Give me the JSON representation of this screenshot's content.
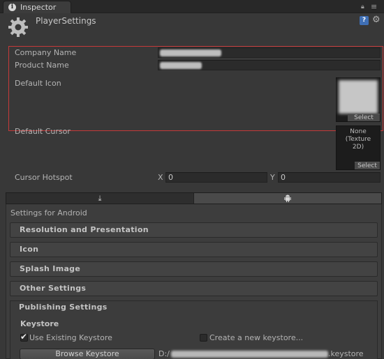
{
  "window": {
    "tab_label": "Inspector"
  },
  "header": {
    "title": "PlayerSettings"
  },
  "general": {
    "company_name_label": "Company Name",
    "product_name_label": "Product Name",
    "default_icon_label": "Default Icon",
    "default_icon_select": "Select",
    "default_cursor_label": "Default Cursor",
    "default_cursor_value_1": "None",
    "default_cursor_value_2": "(Texture",
    "default_cursor_value_3": "2D)",
    "default_cursor_select": "Select",
    "cursor_hotspot_label": "Cursor Hotspot",
    "hotspot_x_label": "X",
    "hotspot_x_value": "0",
    "hotspot_y_label": "Y",
    "hotspot_y_value": "0"
  },
  "platform_tabs": {
    "standalone_icon": "download-icon",
    "android_icon": "android-icon",
    "selected": "android"
  },
  "settings": {
    "settings_for": "Settings for Android",
    "sections": [
      "Resolution and Presentation",
      "Icon",
      "Splash Image",
      "Other Settings",
      "Publishing Settings"
    ]
  },
  "publishing": {
    "keystore_heading": "Keystore",
    "use_existing_label": "Use Existing Keystore",
    "use_existing_checked": true,
    "create_new_label": "Create a new keystore...",
    "create_new_checked": false,
    "browse_button": "Browse Keystore",
    "keystore_path_prefix": "D:/",
    "keystore_path_suffix": ".keystore"
  },
  "colors": {
    "highlight_border": "#c53a3a",
    "background": "#383838"
  }
}
